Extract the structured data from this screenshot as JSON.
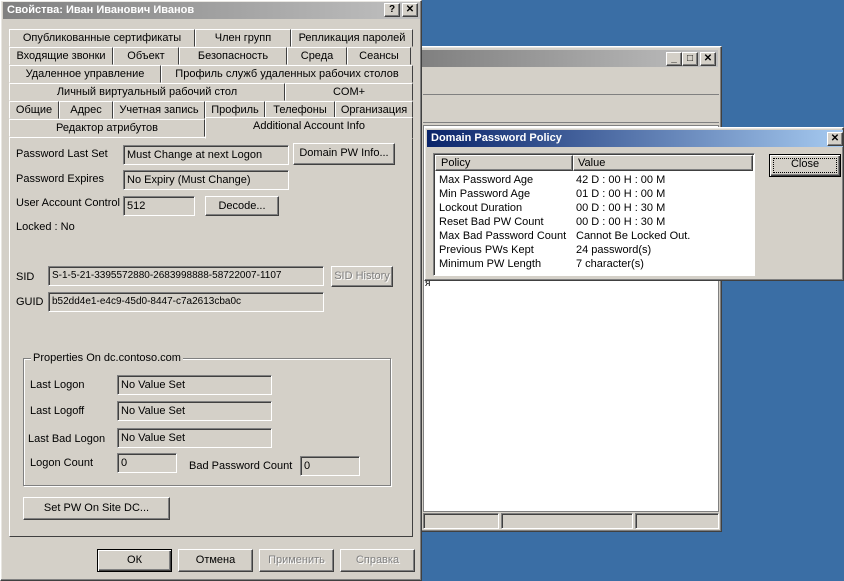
{
  "properties_window": {
    "title": "Свойства: Иван Иванович Иванов",
    "help_btn": "?",
    "close_btn": "✕",
    "tab_rows": [
      [
        "Опубликованные сертификаты",
        "Член групп",
        "Репликация паролей"
      ],
      [
        "Входящие звонки",
        "Объект",
        "Безопасность",
        "Среда",
        "Сеансы"
      ],
      [
        "Удаленное управление",
        "Профиль служб удаленных рабочих столов"
      ],
      [
        "Личный виртуальный рабочий стол",
        "COM+"
      ],
      [
        "Общие",
        "Адрес",
        "Учетная запись",
        "Профиль",
        "Телефоны",
        "Организация"
      ],
      [
        "Редактор атрибутов",
        "Additional Account Info"
      ]
    ],
    "active_tab": "Additional Account Info",
    "password_last_set": {
      "label": "Password Last Set",
      "value": "Must Change at next Logon"
    },
    "domain_pw_info_button": "Domain PW Info...",
    "password_expires": {
      "label": "Password Expires",
      "value": "No Expiry (Must Change)"
    },
    "user_account_control": {
      "label": "User Account Control",
      "value": "512"
    },
    "decode_button": "Decode...",
    "locked": "Locked : No",
    "sid": {
      "label": "SID",
      "value": "S-1-5-21-3395572880-2683998888-58722007-1107"
    },
    "sid_history_button": "SID History",
    "guid": {
      "label": "GUID",
      "value": "b52dd4e1-e4c9-45d0-8447-c7a2613cba0c"
    },
    "properties_group": {
      "title": "Properties On dc.contoso.com",
      "last_logon": {
        "label": "Last Logon",
        "value": "No Value Set"
      },
      "last_logoff": {
        "label": "Last Logoff",
        "value": "No Value Set"
      },
      "last_bad_logon": {
        "label": "Last Bad Logon",
        "value": "No Value Set"
      },
      "logon_count": {
        "label": "Logon Count",
        "value": "0"
      },
      "bad_password_count": {
        "label": "Bad Password Count",
        "value": "0"
      }
    },
    "set_pw_button": "Set PW On Site DC...",
    "ok_button": "ОК",
    "cancel_button": "Отмена",
    "apply_button": "Применить",
    "help_button": "Справка"
  },
  "background_window": {
    "minimize": "_",
    "maximize": "□",
    "close": "✕",
    "glyph": "я"
  },
  "policy_window": {
    "title": "Domain Password Policy",
    "close_btn": "✕",
    "columns": [
      "Policy",
      "Value"
    ],
    "rows": [
      {
        "policy": "Max Password Age",
        "value": "42 D : 00 H : 00 M"
      },
      {
        "policy": "Min Password Age",
        "value": "01 D : 00 H : 00 M"
      },
      {
        "policy": "Lockout Duration",
        "value": "00 D : 00 H : 30 M"
      },
      {
        "policy": "Reset Bad PW Count",
        "value": "00 D : 00 H : 30 M"
      },
      {
        "policy": "Max Bad Password Count",
        "value": "Cannot Be Locked Out."
      },
      {
        "policy": "Previous PWs Kept",
        "value": "24 password(s)"
      },
      {
        "policy": "Minimum PW Length",
        "value": "7 character(s)"
      }
    ],
    "close_button": "Close"
  },
  "colors": {
    "desktop": "#3a6ea5",
    "active_title": "#0a246a",
    "inactive_title": "#808080",
    "face": "#d4d0c8"
  }
}
